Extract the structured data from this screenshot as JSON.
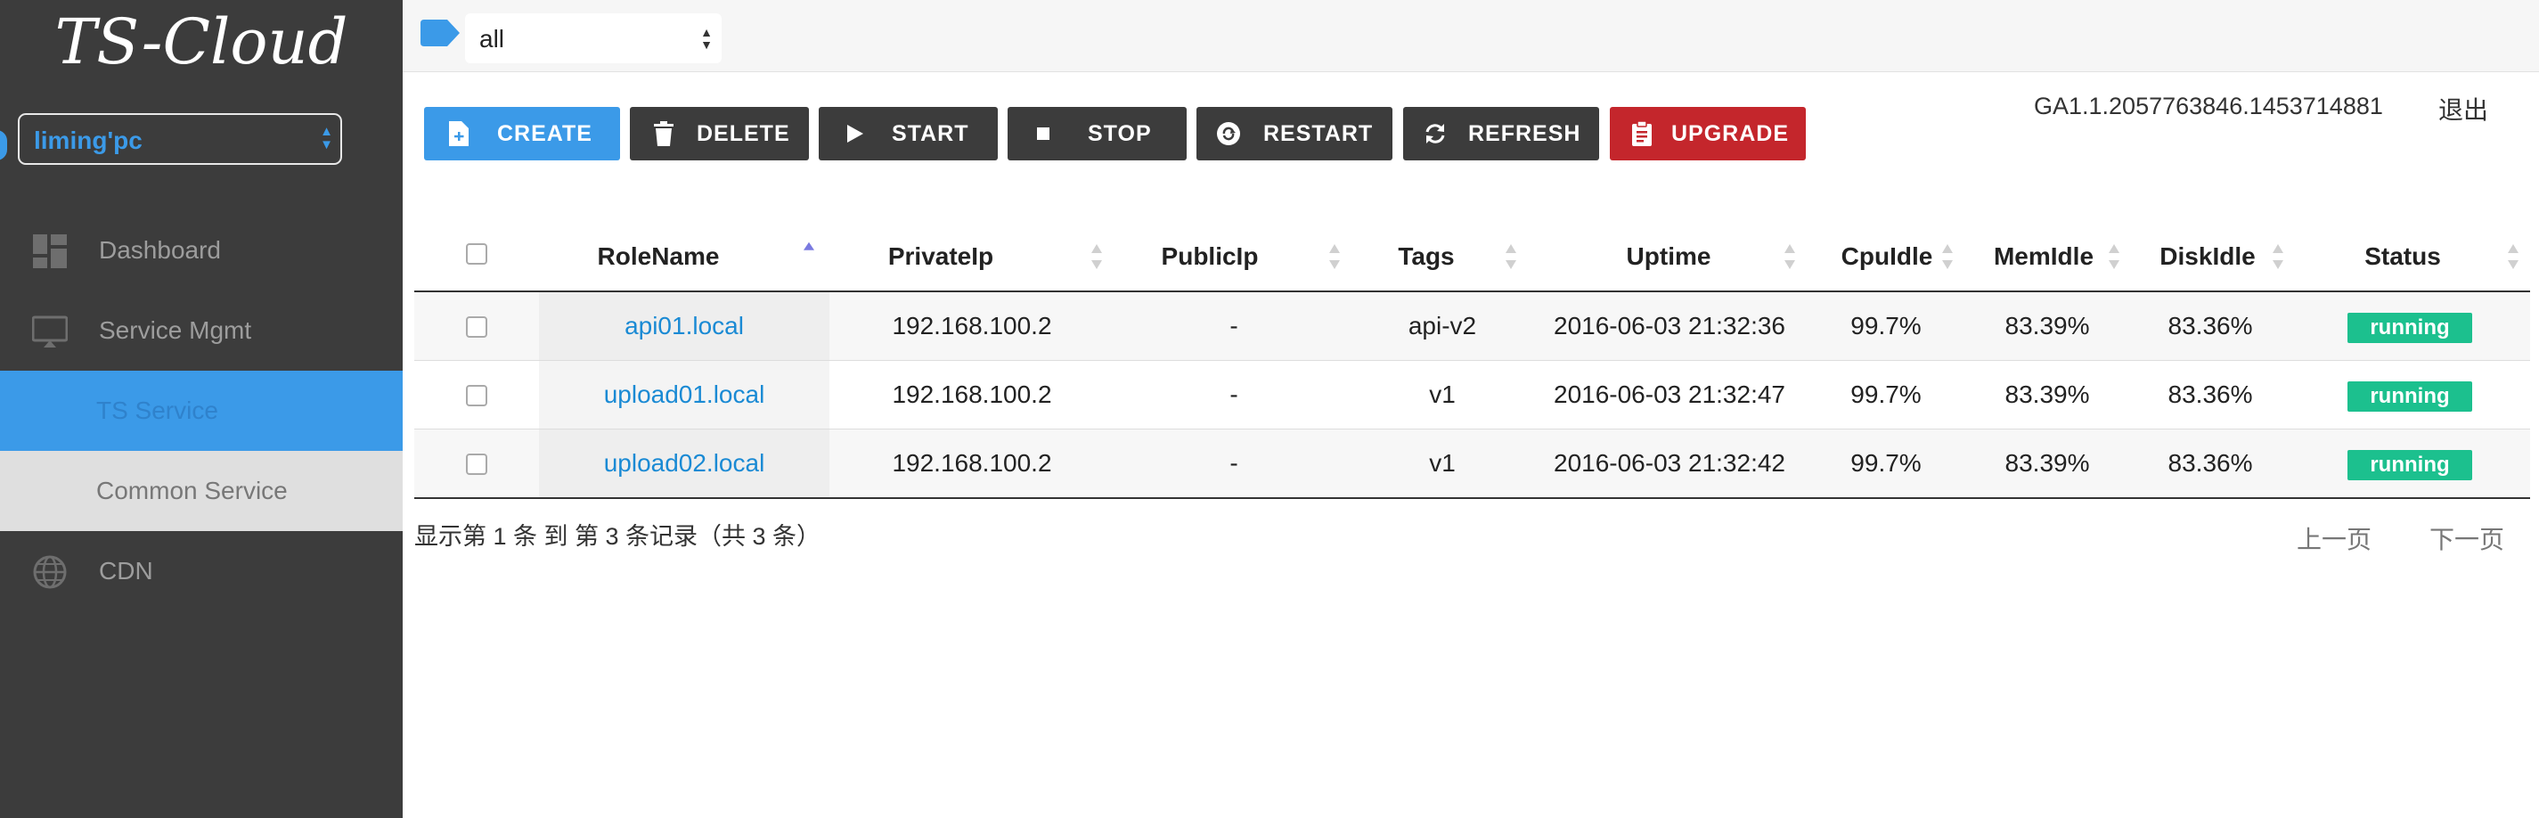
{
  "app": {
    "title": "TS-Cloud"
  },
  "user_select": {
    "value": "liming'pc"
  },
  "sidebar": {
    "items": [
      {
        "label": "Dashboard",
        "icon": "dashboard-icon"
      },
      {
        "label": "Service Mgmt",
        "icon": "monitor-icon"
      },
      {
        "label": "TS Service",
        "active": true
      },
      {
        "label": "Common Service"
      },
      {
        "label": "CDN",
        "icon": "globe-icon"
      }
    ]
  },
  "topbar": {
    "filter_value": "all",
    "tag_icon": "tag-icon"
  },
  "header": {
    "ga_id": "GA1.1.2057763846.1453714881",
    "logout_label": "退出"
  },
  "toolbar": {
    "create": "CREATE",
    "delete": "DELETE",
    "start": "START",
    "stop": "STOP",
    "restart": "RESTART",
    "refresh": "REFRESH",
    "upgrade": "UPGRADE"
  },
  "table": {
    "columns": [
      "RoleName",
      "PrivateIp",
      "PublicIp",
      "Tags",
      "Uptime",
      "CpuIdle",
      "MemIdle",
      "DiskIdle",
      "Status"
    ],
    "rows": [
      {
        "role": "api01.local",
        "private_ip": "192.168.100.2",
        "public_ip": "-",
        "tags": "api-v2",
        "uptime": "2016-06-03 21:32:36",
        "cpu": "99.7%",
        "mem": "83.39%",
        "disk": "83.36%",
        "status": "running"
      },
      {
        "role": "upload01.local",
        "private_ip": "192.168.100.2",
        "public_ip": "-",
        "tags": "v1",
        "uptime": "2016-06-03 21:32:47",
        "cpu": "99.7%",
        "mem": "83.39%",
        "disk": "83.36%",
        "status": "running"
      },
      {
        "role": "upload02.local",
        "private_ip": "192.168.100.2",
        "public_ip": "-",
        "tags": "v1",
        "uptime": "2016-06-03 21:32:42",
        "cpu": "99.7%",
        "mem": "83.39%",
        "disk": "83.36%",
        "status": "running"
      }
    ]
  },
  "footer": {
    "info": "显示第 1 条 到 第 3 条记录（共 3 条）",
    "prev": "上一页",
    "next": "下一页"
  },
  "colors": {
    "accent": "#3b9ae8",
    "sidebar_bg": "#3c3c3c",
    "danger": "#c4262c",
    "status_running": "#1cc08e",
    "link": "#1a8ad4"
  }
}
